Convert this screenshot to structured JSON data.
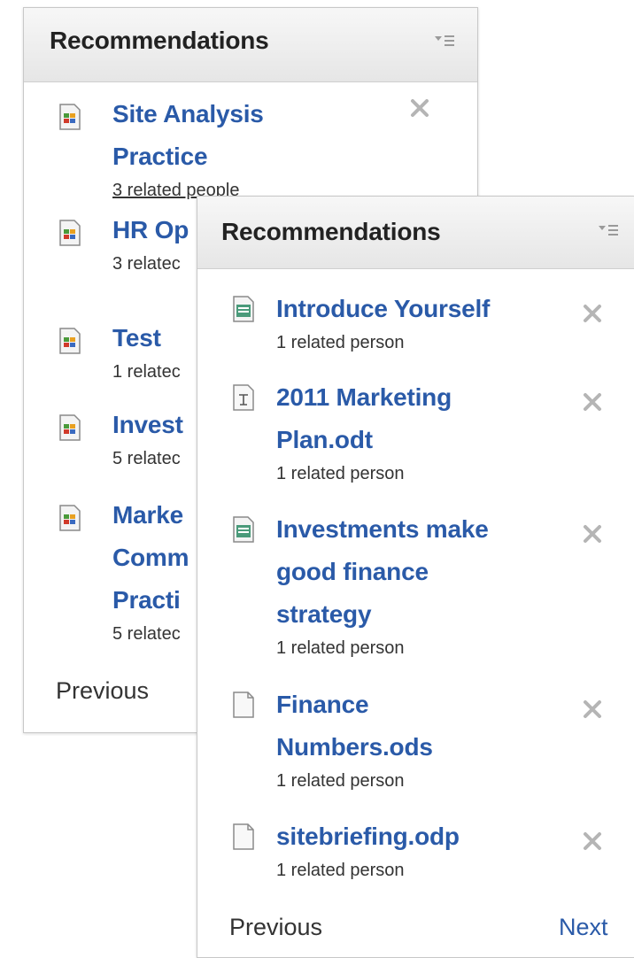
{
  "back_widget": {
    "title": "Recommendations",
    "items": [
      {
        "title_line1": "Site Analysis",
        "title_line2": "Practice",
        "subtitle": "3 related people"
      },
      {
        "title_line1": "HR Op",
        "subtitle": "3 relatec"
      },
      {
        "title_line1": "Test",
        "subtitle": "1 relatec"
      },
      {
        "title_line1": "Invest",
        "subtitle": "5 relatec"
      },
      {
        "title_line1": "Marke",
        "title_line2": "Comm",
        "title_line3": "Practi",
        "subtitle": "5 relatec"
      }
    ],
    "previous_label": "Previous"
  },
  "front_widget": {
    "title": "Recommendations",
    "items": [
      {
        "title_line1": "Introduce Yourself",
        "subtitle": "1 related person",
        "icon": "text-document-icon"
      },
      {
        "title_line1": "2011 Marketing",
        "title_line2": "Plan.odt",
        "subtitle": "1 related person",
        "icon": "odt-document-icon"
      },
      {
        "title_line1": "Investments make",
        "title_line2": "good finance",
        "title_line3": "strategy",
        "subtitle": "1 related person",
        "icon": "text-document-icon"
      },
      {
        "title_line1": "Finance",
        "title_line2": "Numbers.ods",
        "subtitle": "1 related person",
        "icon": "blank-document-icon"
      },
      {
        "title_line1": "sitebriefing.odp",
        "subtitle": "1 related person",
        "icon": "blank-document-icon"
      }
    ],
    "previous_label": "Previous",
    "next_label": "Next"
  },
  "colors": {
    "link": "#2a5aa8",
    "text": "#333333",
    "header_bg": "#e6e6e6",
    "close": "#b5b5b5"
  }
}
